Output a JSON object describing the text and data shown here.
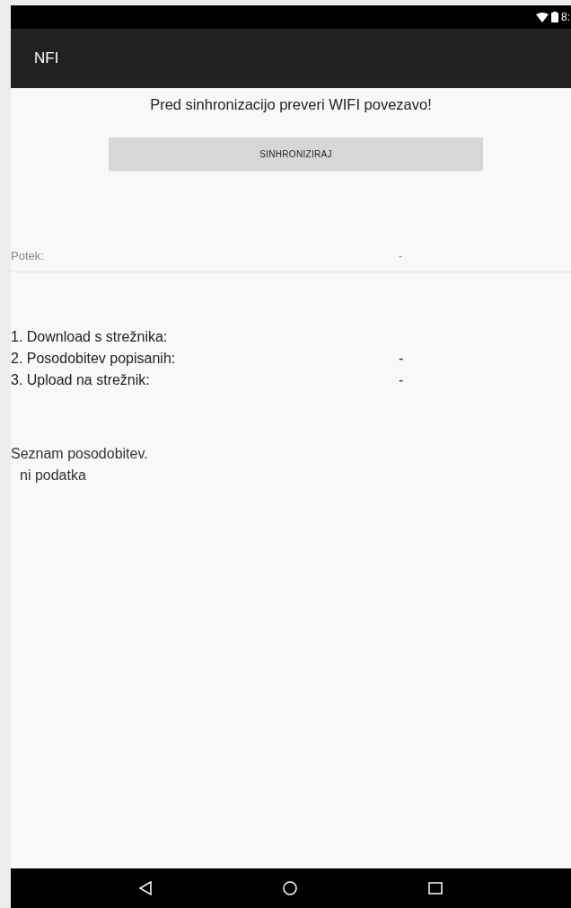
{
  "status_bar": {
    "time": "8:"
  },
  "app_bar": {
    "title": "NFI"
  },
  "notice": "Pred sinhronizacijo preveri WIFI povezavo!",
  "sync_button": {
    "label": "SINHRONIZIRAJ"
  },
  "progress": {
    "label": "Potek:",
    "value": "-"
  },
  "steps": [
    {
      "label": "1. Download s strežnika:"
    },
    {
      "label": "2. Posodobitev popisanih:",
      "value": "-"
    },
    {
      "label": "3. Upload na strežnik:",
      "value": "-"
    }
  ],
  "updates": {
    "title": "Seznam posodobitev.",
    "empty": "ni podatka"
  }
}
